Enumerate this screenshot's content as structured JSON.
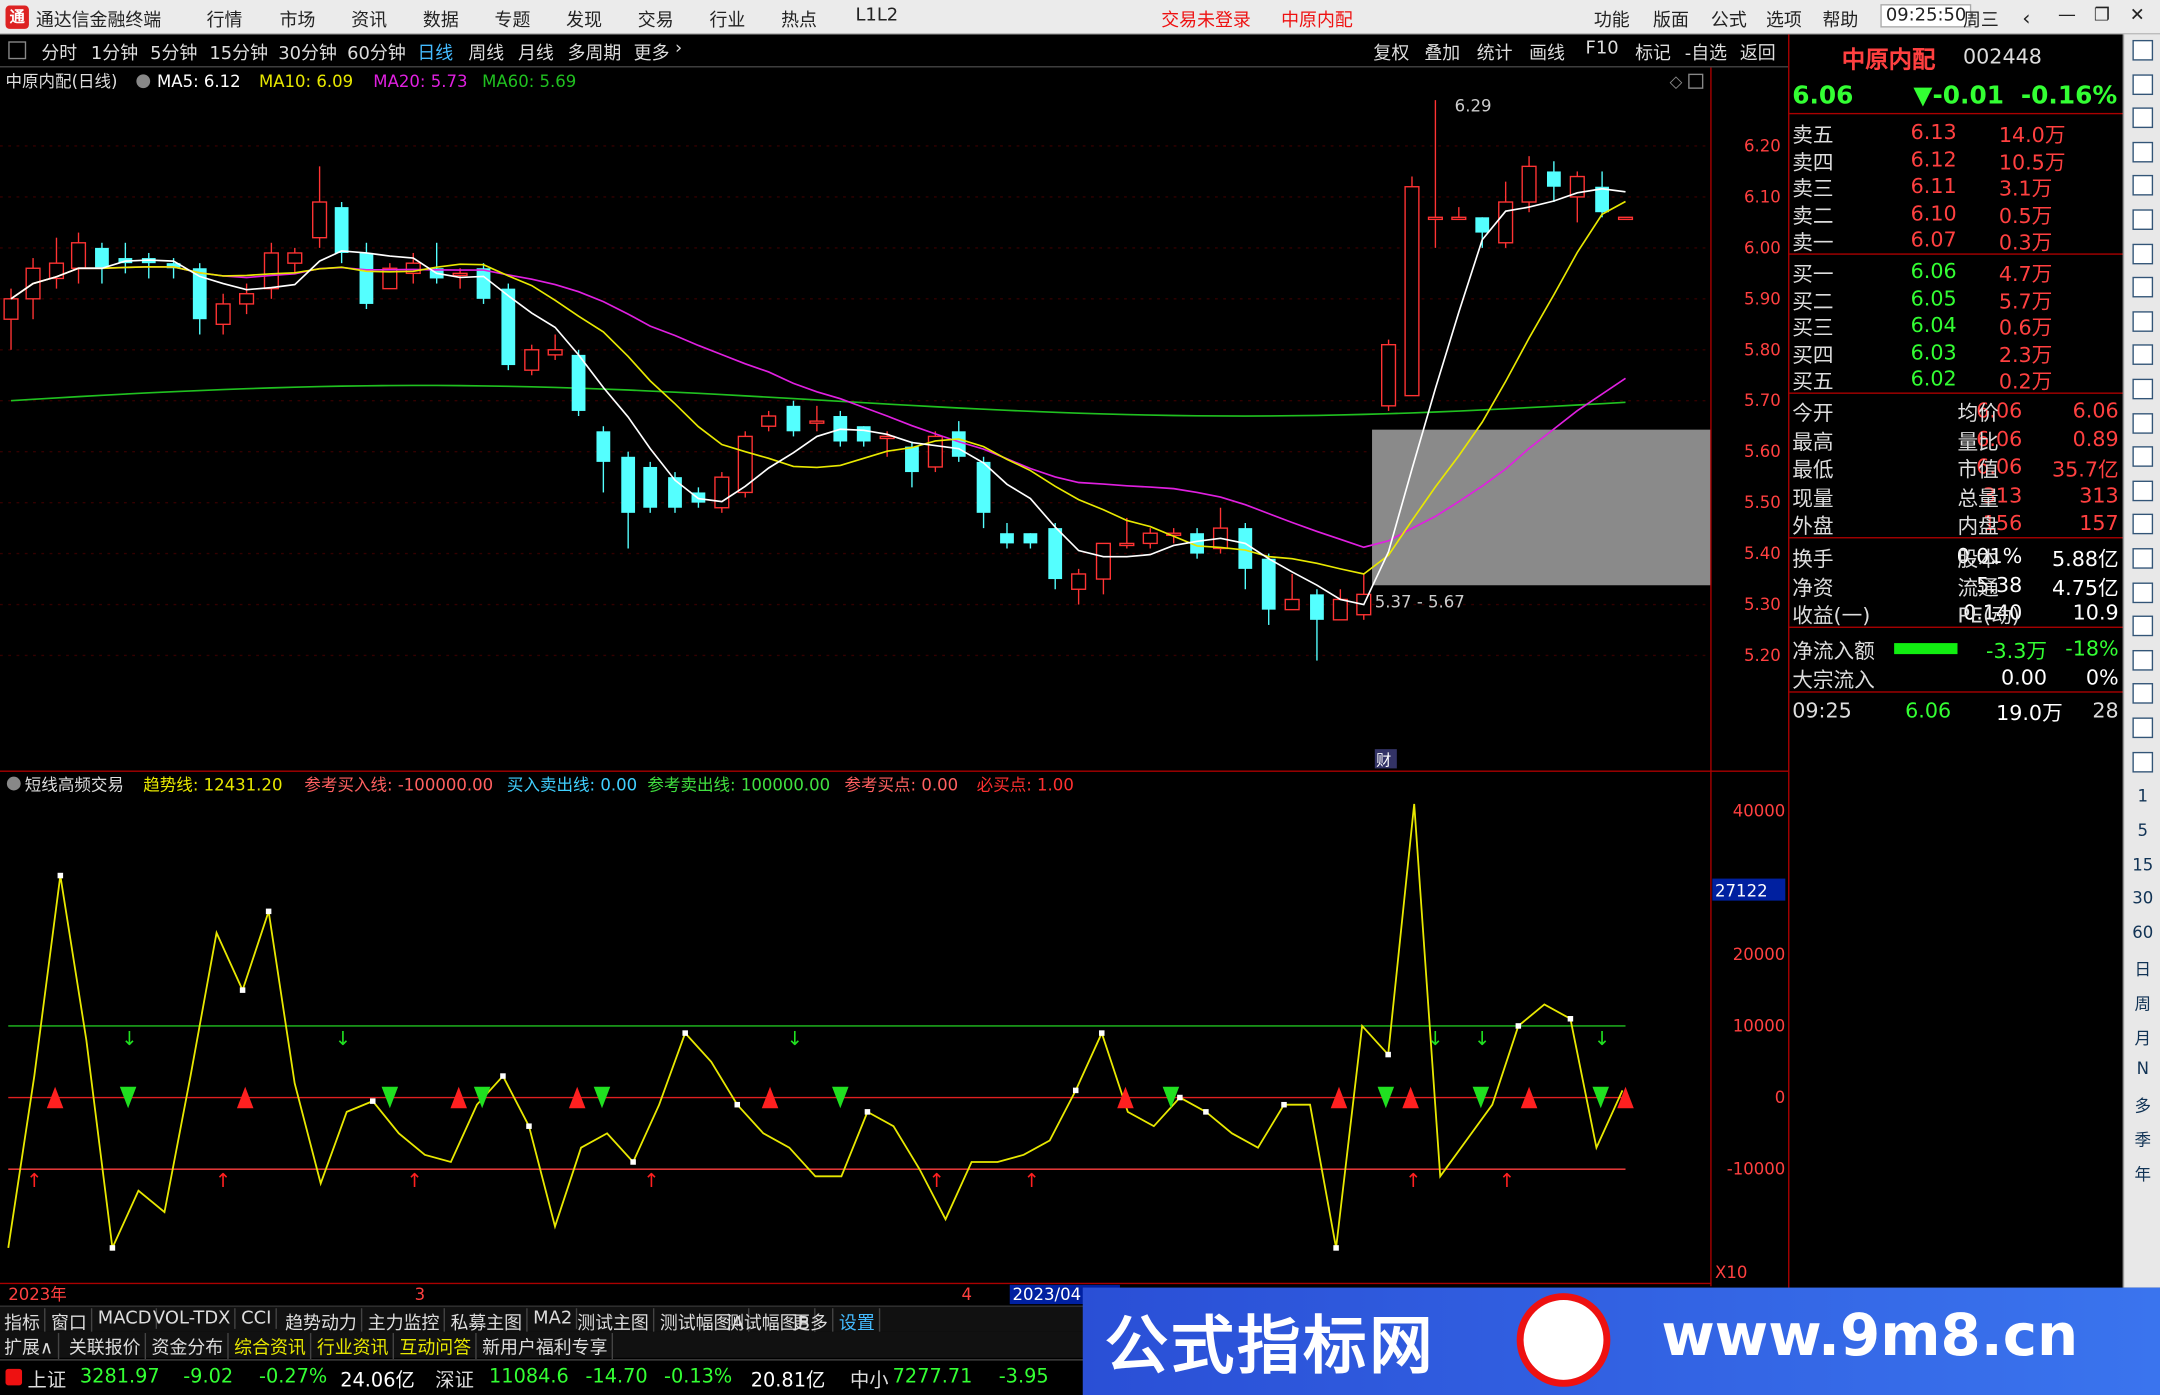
{
  "titlebar": {
    "app_name": "通达信金融终端",
    "menus": [
      "行情",
      "市场",
      "资讯",
      "数据",
      "专题",
      "发现",
      "交易",
      "行业",
      "热点",
      "L1L2"
    ],
    "login": "交易未登录",
    "stock": "中原内配",
    "right_menus": [
      "功能",
      "版面",
      "公式",
      "选项",
      "帮助"
    ],
    "time": "09:25:50",
    "weekday": "周三"
  },
  "periods": [
    "分时",
    "1分钟",
    "5分钟",
    "15分钟",
    "30分钟",
    "60分钟",
    "日线",
    "周线",
    "月线",
    "多周期",
    "更多"
  ],
  "selected_period": "日线",
  "tools": [
    "复权",
    "叠加",
    "统计",
    "画线",
    "F10",
    "标记",
    "-自选",
    "返回"
  ],
  "main_legend": {
    "name": "中原内配(日线)",
    "ma5": "MA5: 6.12",
    "ma10": "MA10: 6.09",
    "ma20": "MA20: 5.73",
    "ma60": "MA60: 5.69"
  },
  "price_axis": [
    "6.20",
    "6.10",
    "6.00",
    "5.90",
    "5.80",
    "5.70",
    "5.60",
    "5.50",
    "5.40",
    "5.30",
    "5.20"
  ],
  "annotations": {
    "high": "6.29",
    "range": "5.37 - 5.67",
    "cai": "财"
  },
  "indicator_legend": {
    "name": "短线高频交易",
    "trend": "趋势线: 12431.20",
    "ref_buy": "参考买入线: -100000.00",
    "buy_sell": "买入卖出线: 0.00",
    "ref_sell": "参考卖出线: 100000.00",
    "ref_buy_pt": "参考买点: 0.00",
    "must_buy": "必买点: 1.00"
  },
  "ind_axis": [
    "40000",
    "20000",
    "10000",
    "0",
    "-10000"
  ],
  "ind_cursor": "27122",
  "ind_mult": "X10",
  "date_axis": {
    "year": "2023年",
    "m3": "3",
    "m4": "4",
    "sel": "2023/04"
  },
  "quote": {
    "name": "中原内配",
    "code": "002448",
    "price": "6.06",
    "change": "▼-0.01",
    "pct": "-0.16%"
  },
  "asks": [
    {
      "label": "卖五",
      "p": "6.13",
      "v": "14.0万"
    },
    {
      "label": "卖四",
      "p": "6.12",
      "v": "10.5万"
    },
    {
      "label": "卖三",
      "p": "6.11",
      "v": "3.1万"
    },
    {
      "label": "卖二",
      "p": "6.10",
      "v": "0.5万"
    },
    {
      "label": "卖一",
      "p": "6.07",
      "v": "0.3万"
    }
  ],
  "bids": [
    {
      "label": "买一",
      "p": "6.06",
      "v": "4.7万"
    },
    {
      "label": "买二",
      "p": "6.05",
      "v": "5.7万"
    },
    {
      "label": "买三",
      "p": "6.04",
      "v": "0.6万"
    },
    {
      "label": "买四",
      "p": "6.03",
      "v": "2.3万"
    },
    {
      "label": "买五",
      "p": "6.02",
      "v": "0.2万"
    }
  ],
  "stats": [
    [
      "今开",
      "6.06",
      "均价",
      "6.06"
    ],
    [
      "最高",
      "6.06",
      "量比",
      "0.89"
    ],
    [
      "最低",
      "6.06",
      "市值",
      "35.7亿"
    ],
    [
      "现量",
      "313",
      "总量",
      "313"
    ],
    [
      "外盘",
      "156",
      "内盘",
      "157"
    ]
  ],
  "stats2": [
    [
      "换手",
      "0.01%",
      "股本",
      "5.88亿"
    ],
    [
      "净资",
      "5.38",
      "流通",
      "4.75亿"
    ],
    [
      "收益(一)",
      "0.140",
      "PE(动)",
      "10.9"
    ]
  ],
  "flow": [
    {
      "label": "净流入额",
      "v": "-3.3万",
      "p": "-18%"
    },
    {
      "label": "大宗流入",
      "v": "0.00",
      "p": "0%"
    }
  ],
  "tick": {
    "time": "09:25",
    "price": "6.06",
    "vol": "19.0万",
    "n": "28"
  },
  "side_buttons": [
    "1",
    "5",
    "15",
    "30",
    "60",
    "日",
    "周",
    "月",
    "N",
    "多",
    "季",
    "年"
  ],
  "bottom_tabs": [
    "指标",
    "窗口",
    "MACD",
    "VOL-TDX",
    "CCI",
    "趋势动力",
    "主力监控",
    "私募主图",
    "MA2",
    "测试主图",
    "测试幅图A",
    "测试幅图B",
    "更多",
    "设置"
  ],
  "bottom_tabs2": [
    "扩展∧",
    "关联报价",
    "资金分布",
    "综合资讯",
    "行业资讯",
    "互动问答",
    "新用户福利专享"
  ],
  "index_bar": [
    {
      "name": "上证",
      "v": "3281.97",
      "c": "-9.02",
      "p": "-0.27%",
      "a": "24.06亿"
    },
    {
      "name": "深证",
      "v": "11084.6",
      "c": "-14.70",
      "p": "-0.13%",
      "a": "20.81亿"
    },
    {
      "name": "中小",
      "v": "7277.71",
      "c": "-3.95"
    }
  ],
  "ad": {
    "text": "公式指标网",
    "url": "www.9m8.cn"
  },
  "colors": {
    "up": "#ff3333",
    "down": "#54ffff",
    "ma5": "#ffffff",
    "ma10": "#e8e800",
    "ma20": "#e020e0",
    "ma60": "#20c020"
  }
}
